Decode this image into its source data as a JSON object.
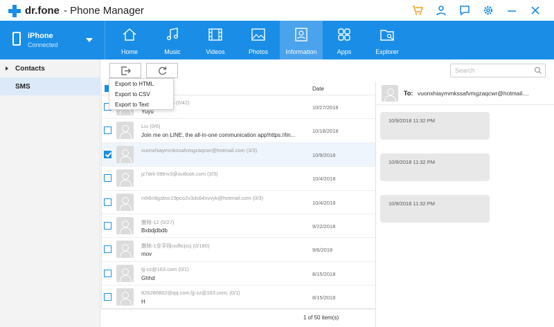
{
  "app": {
    "brand": "dr.fone",
    "title": "- Phone Manager"
  },
  "window_icons": [
    "cart-icon",
    "user-icon",
    "feedback-icon",
    "settings-icon",
    "minimize-icon",
    "close-icon"
  ],
  "device": {
    "name": "iPhone",
    "status": "Connected"
  },
  "tabs": [
    {
      "label": "Home",
      "icon": "home-icon"
    },
    {
      "label": "Music",
      "icon": "music-icon"
    },
    {
      "label": "Videos",
      "icon": "video-icon"
    },
    {
      "label": "Photos",
      "icon": "photo-icon"
    },
    {
      "label": "Information",
      "icon": "information-icon",
      "active": true
    },
    {
      "label": "Apps",
      "icon": "apps-icon"
    },
    {
      "label": "Explorer",
      "icon": "explorer-icon"
    }
  ],
  "sidebar": {
    "items": [
      {
        "label": "Contacts",
        "expandable": true
      },
      {
        "label": "SMS",
        "selected": true
      }
    ]
  },
  "toolbar": {
    "export_icon": "export-icon",
    "refresh_icon": "refresh-icon"
  },
  "search": {
    "placeholder": "Search"
  },
  "export_menu": {
    "items": [
      "Export to HTML",
      "Export to CSV",
      "Export to Text"
    ]
  },
  "list": {
    "date_header": "Date",
    "rows": [
      {
        "contact": "ondershare.cn   (0/42)",
        "preview": "Yuyu",
        "date": "10/27/2018",
        "checked": false
      },
      {
        "contact": "Liu   (0/6)",
        "preview": "Join me on LINE, the all-in-one communication app!https://lin...",
        "date": "10/18/2018",
        "checked": false
      },
      {
        "contact": "vuonxhiaymmkssafvmgzaqcwr@hotmail.com   (3/3)",
        "preview": "",
        "date": "10/9/2018",
        "checked": true
      },
      {
        "contact": "jz7drk-09tnv3@outlook.com   (3/3)",
        "preview": "",
        "date": "10/4/2018",
        "checked": false
      },
      {
        "contact": "rxh6n9gsbvc19pco2v3ds64nvvyk@hotmail.com   (0/3)",
        "preview": "",
        "date": "10/4/2018",
        "checked": false
      },
      {
        "contact": "删除-12   (0/27)",
        "preview": "Bxbdjdbdb",
        "date": "9/22/2018",
        "checked": false
      },
      {
        "contact": "删除-1全字段uuflicjccj   (0/180)",
        "preview": "mov",
        "date": "9/6/2018",
        "checked": false
      },
      {
        "contact": "ljj-zz@163.com   (0/1)",
        "preview": "Ghhd",
        "date": "8/15/2018",
        "checked": false
      },
      {
        "contact": "826280802@qq.com;ljj-zz@163.com;   (0/1)",
        "preview": "H",
        "date": "8/15/2018",
        "checked": false
      }
    ]
  },
  "pager": {
    "text": "1  of  50  item(s)"
  },
  "conversation": {
    "to_label": "To:",
    "to_value": "vuonxhiaymmkssafvmgzaqcwr@hotmail....",
    "messages": [
      {
        "time": "10/9/2018 11:32 PM"
      },
      {
        "time": "10/9/2018 11:32 PM"
      },
      {
        "time": "10/9/2018 11:32 PM"
      }
    ]
  },
  "colors": {
    "accent": "#1a8ee6",
    "selected_bg": "#dce9f8"
  }
}
